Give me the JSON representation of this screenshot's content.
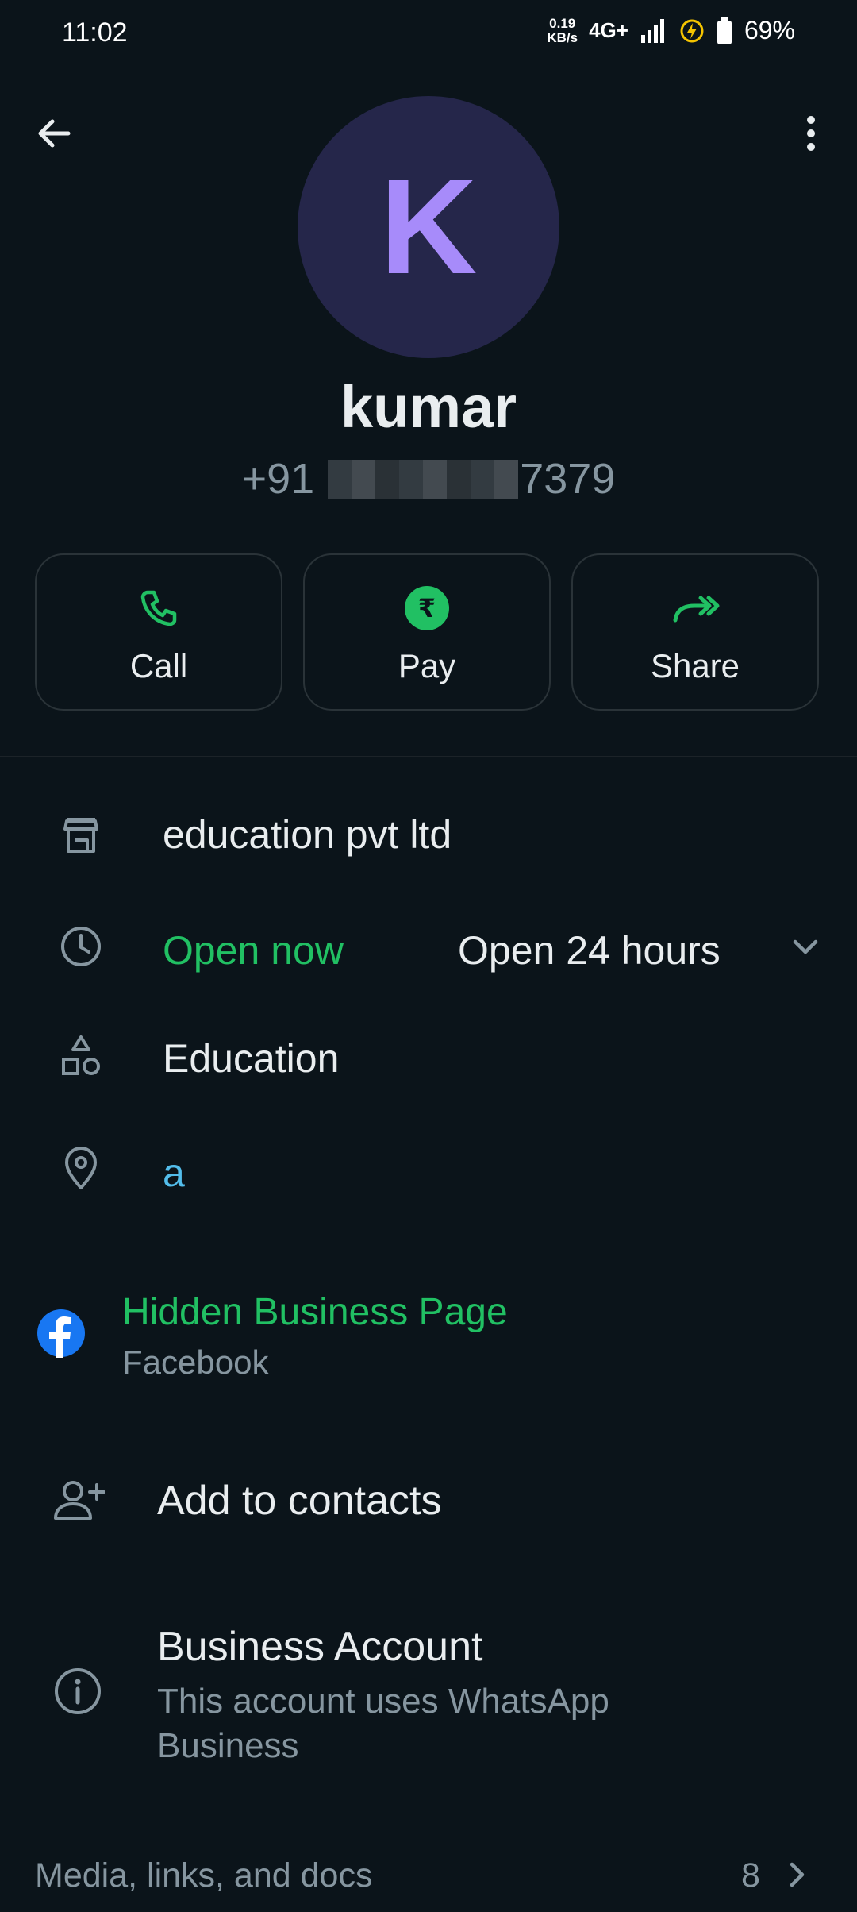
{
  "status_bar": {
    "time": "11:02",
    "net_speed_value": "0.19",
    "net_speed_unit": "KB/s",
    "network": "4G+",
    "battery": "69%"
  },
  "profile": {
    "avatar_letter": "K",
    "name": "kumar",
    "phone_prefix": "+91",
    "phone_suffix": "7379"
  },
  "actions": [
    {
      "label": "Call",
      "icon": "phone-icon"
    },
    {
      "label": "Pay",
      "icon": "rupee-icon"
    },
    {
      "label": "Share",
      "icon": "share-icon"
    }
  ],
  "business": {
    "name": "education pvt ltd",
    "hours_status": "Open now",
    "hours": "Open 24 hours",
    "category": "Education",
    "address": "a"
  },
  "facebook": {
    "title": "Hidden Business Page",
    "subtitle": "Facebook"
  },
  "add_contacts": "Add to contacts",
  "business_account": {
    "title": "Business Account",
    "desc_line1": "This account uses WhatsApp",
    "desc_line2": "Business"
  },
  "media": {
    "label": "Media, links, and docs",
    "count": "8"
  },
  "colors": {
    "background": "#0b141a",
    "accent": "#21c063",
    "avatar_bg": "#25264a",
    "avatar_letter": "#a78bfa",
    "link": "#53bdeb"
  }
}
